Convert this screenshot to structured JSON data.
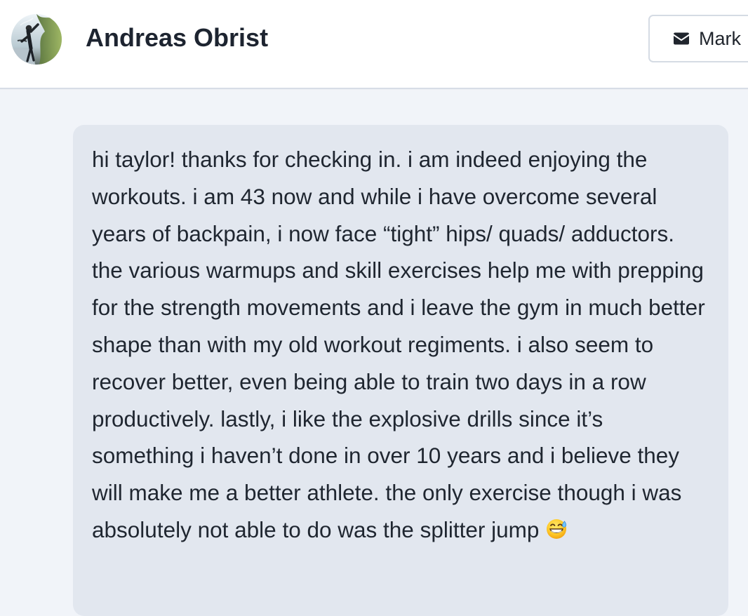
{
  "header": {
    "user_name": "Andreas Obrist",
    "mark_button_label": "Mark",
    "avatar_icon": "profile-photo",
    "mail_icon": "envelope-icon"
  },
  "message": {
    "text": "hi taylor! thanks for checking in. i am indeed enjoying the workouts. i am 43 now and while i have overcome several years of backpain, i now face “tight” hips/ quads/ adductors. the various warmups and skill exercises help me with prepping for the strength movements and i leave the gym in much better shape than with my old workout regiments. i also seem to recover better, even being able to train two days in a row productively. lastly, i like the explosive drills since it’s something i haven’t done in over 10 years and i believe they will make me a better athlete. the only exercise though i was absolutely not able to do was the splitter jump",
    "emoji": "grinning-face-with-sweat-icon"
  },
  "colors": {
    "page_background": "#f1f4f9",
    "header_background": "#ffffff",
    "message_background": "#e2e7ef",
    "text": "#1f2630",
    "border": "#d5dbe4"
  }
}
